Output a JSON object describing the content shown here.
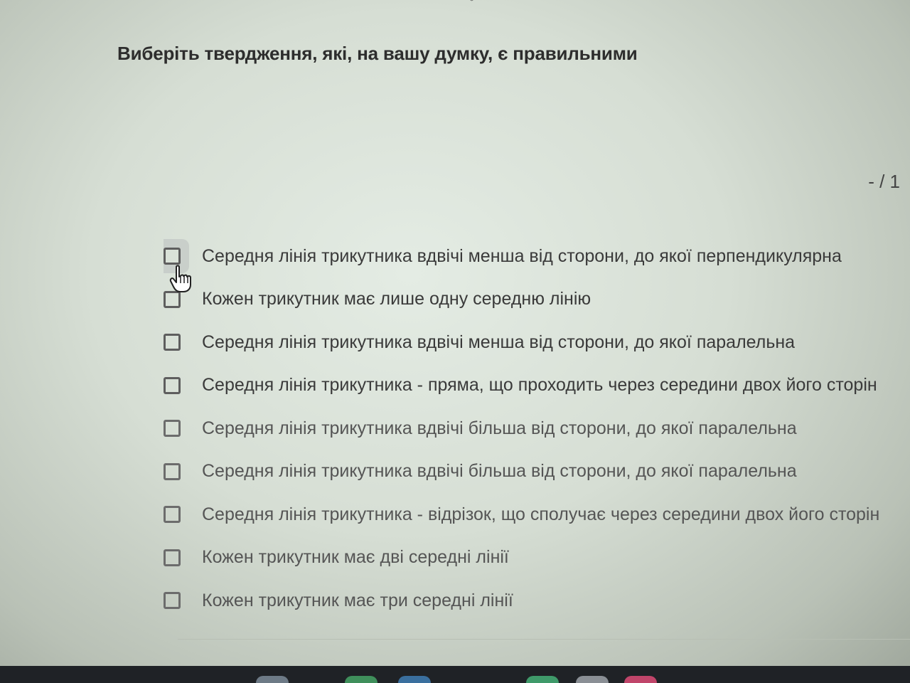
{
  "question": {
    "title": "Виберіть твердження, які, на вашу думку, є правильними",
    "score": "- / 1"
  },
  "options": [
    {
      "label": "Середня лінія трикутника вдвічі менша від сторони, до якої перпендикулярна",
      "checked": false
    },
    {
      "label": "Кожен трикутник має лише одну середню лінію",
      "checked": false
    },
    {
      "label": "Середня лінія трикутника вдвічі менша від сторони, до якої паралельна",
      "checked": false
    },
    {
      "label": "Середня лінія трикутника - пряма, що проходить через середини двох його сторін",
      "checked": false
    },
    {
      "label": "Середня лінія трикутника вдвічі більша від сторони, до якої паралельна",
      "checked": false
    },
    {
      "label": "Середня лінія трикутника вдвічі більша від сторони, до якої паралельна",
      "checked": false
    },
    {
      "label": "Середня лінія трикутника - відрізок, що сполучає через середини двох його сторін",
      "checked": false
    },
    {
      "label": "Кожен трикутник має дві середні лінії",
      "checked": false
    },
    {
      "label": "Кожен трикутник має три середні лінії",
      "checked": false
    }
  ],
  "icons": {
    "cursor": "hand-pointer-icon",
    "checkbox": "checkbox-empty"
  },
  "colors": {
    "taskbar": "#1f2226",
    "checkbox_border": "#5e5e5e"
  }
}
